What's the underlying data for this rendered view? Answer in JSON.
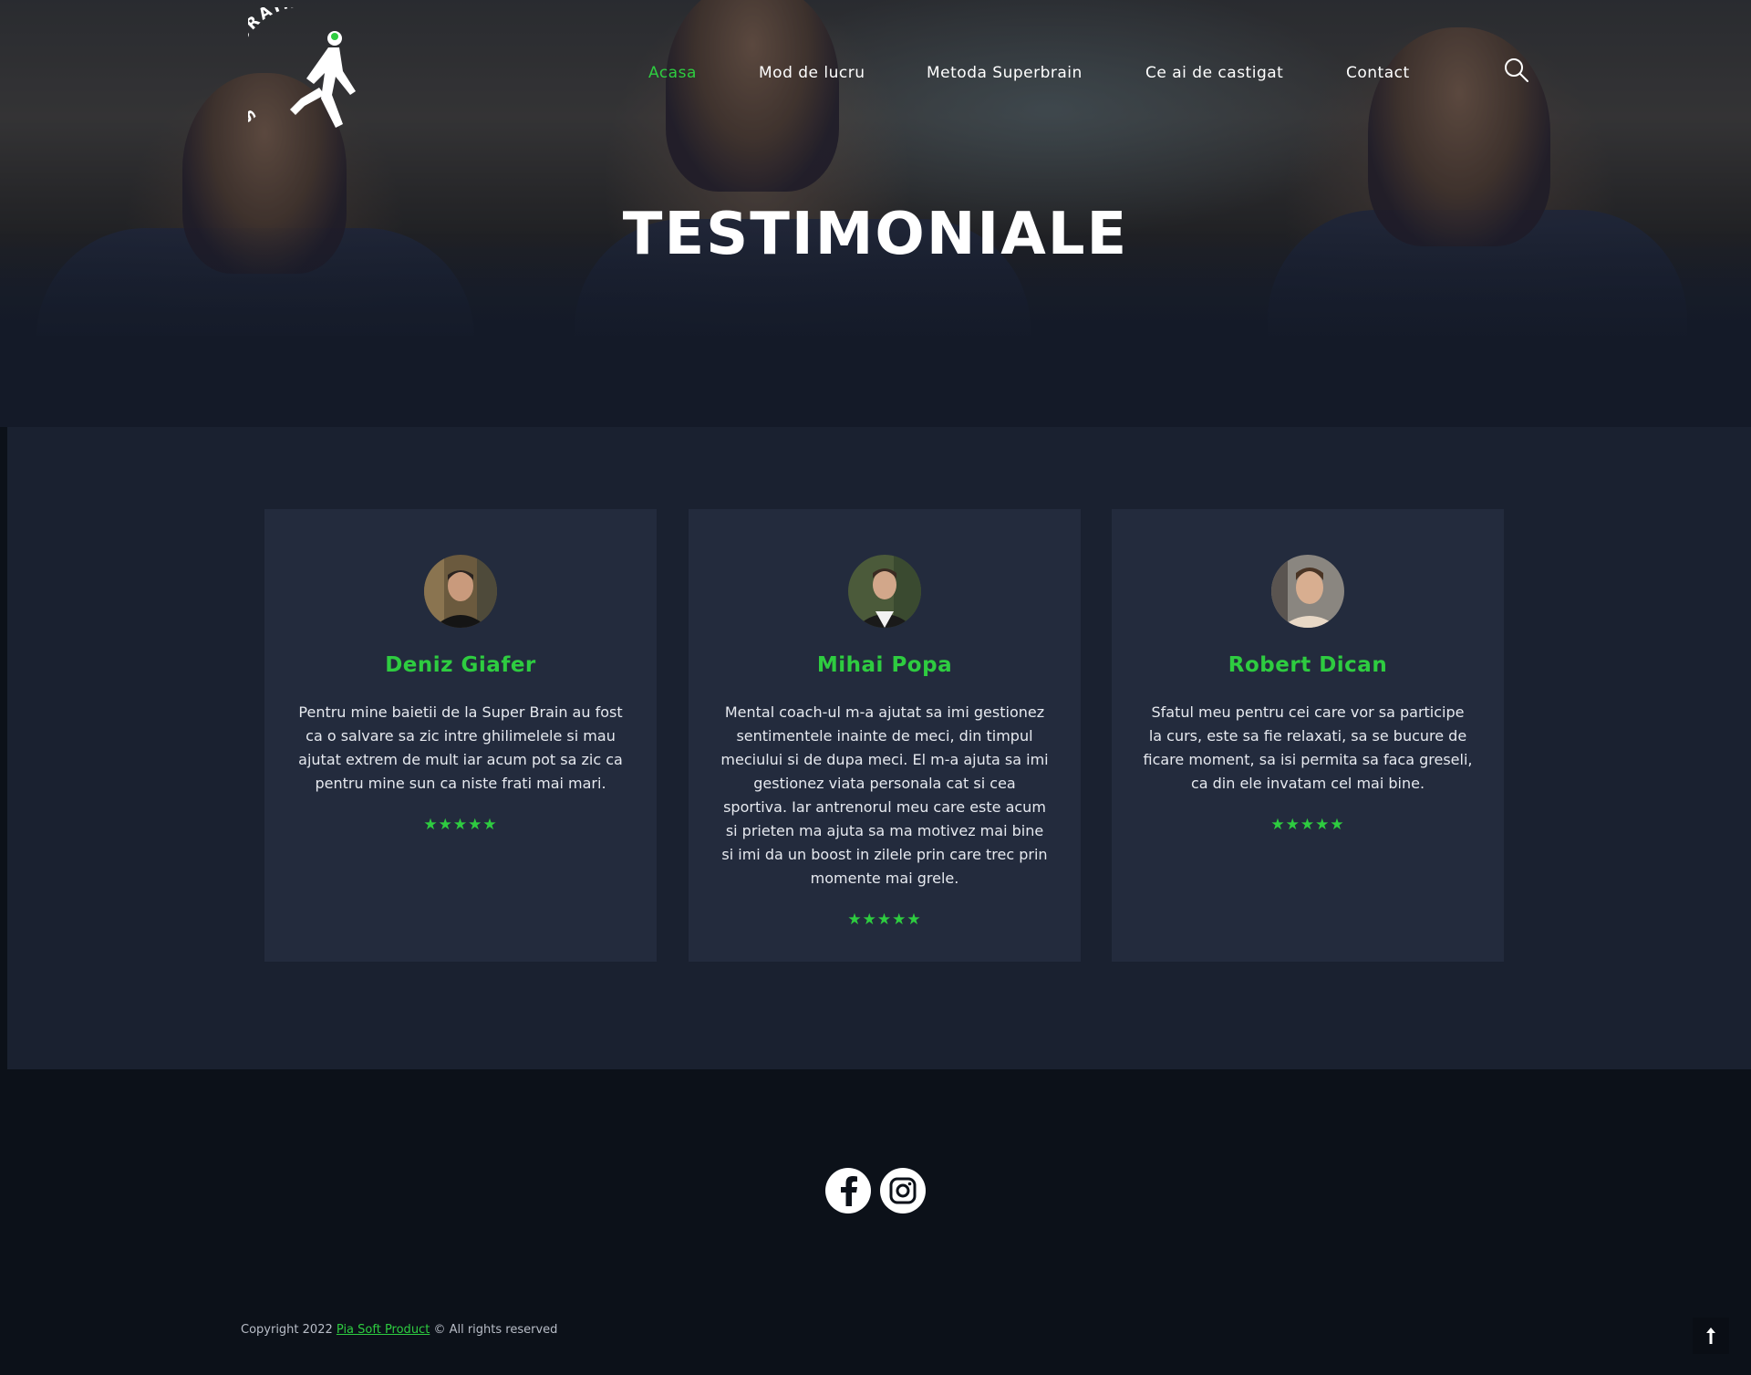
{
  "brand": {
    "logo_text": "SUPER BRAIN"
  },
  "nav": {
    "items": [
      {
        "label": "Acasa",
        "active": true
      },
      {
        "label": "Mod de lucru",
        "active": false
      },
      {
        "label": "Metoda Superbrain",
        "active": false
      },
      {
        "label": "Ce ai de castigat",
        "active": false
      },
      {
        "label": "Contact",
        "active": false
      }
    ],
    "search_icon": "search-icon"
  },
  "hero": {
    "title": "TESTIMONIALE"
  },
  "testimonials": [
    {
      "name": "Deniz Giafer",
      "text": "Pentru mine baietii de la Super Brain au fost ca o salvare sa zic intre ghilimelele si mau ajutat extrem de mult iar acum pot sa zic ca pentru mine sun ca niste frati mai mari.",
      "stars": "★★★★★",
      "rating": 5
    },
    {
      "name": "Mihai Popa",
      "text": "Mental coach-ul m-a ajutat sa imi gestionez sentimentele inainte de meci, din timpul meciului si de dupa meci. El m-a ajuta sa imi gestionez viata personala cat si cea sportiva. Iar antrenorul meu care este acum si prieten ma ajuta sa ma motivez mai bine si imi da un boost in zilele prin care trec prin momente mai grele.",
      "stars": "★★★★★",
      "rating": 5
    },
    {
      "name": "Robert Dican",
      "text": "Sfatul meu pentru cei care vor sa participe la curs, este sa fie relaxati, sa se bucure de ficare moment, sa isi permita sa faca greseli, ca din ele invatam cel mai bine.",
      "stars": "★★★★★",
      "rating": 5
    }
  ],
  "footer": {
    "social": [
      "facebook-icon",
      "instagram-icon"
    ],
    "copyright_prefix": "Copyright 2022",
    "copyright_brand": "Pia Soft Product",
    "copyright_suffix": "© All rights reserved",
    "to_top_glyph": "🠕"
  },
  "colors": {
    "accent": "#2ecc40",
    "background": "#0c1119",
    "section": "#1a2130",
    "card": "#232b3d"
  }
}
